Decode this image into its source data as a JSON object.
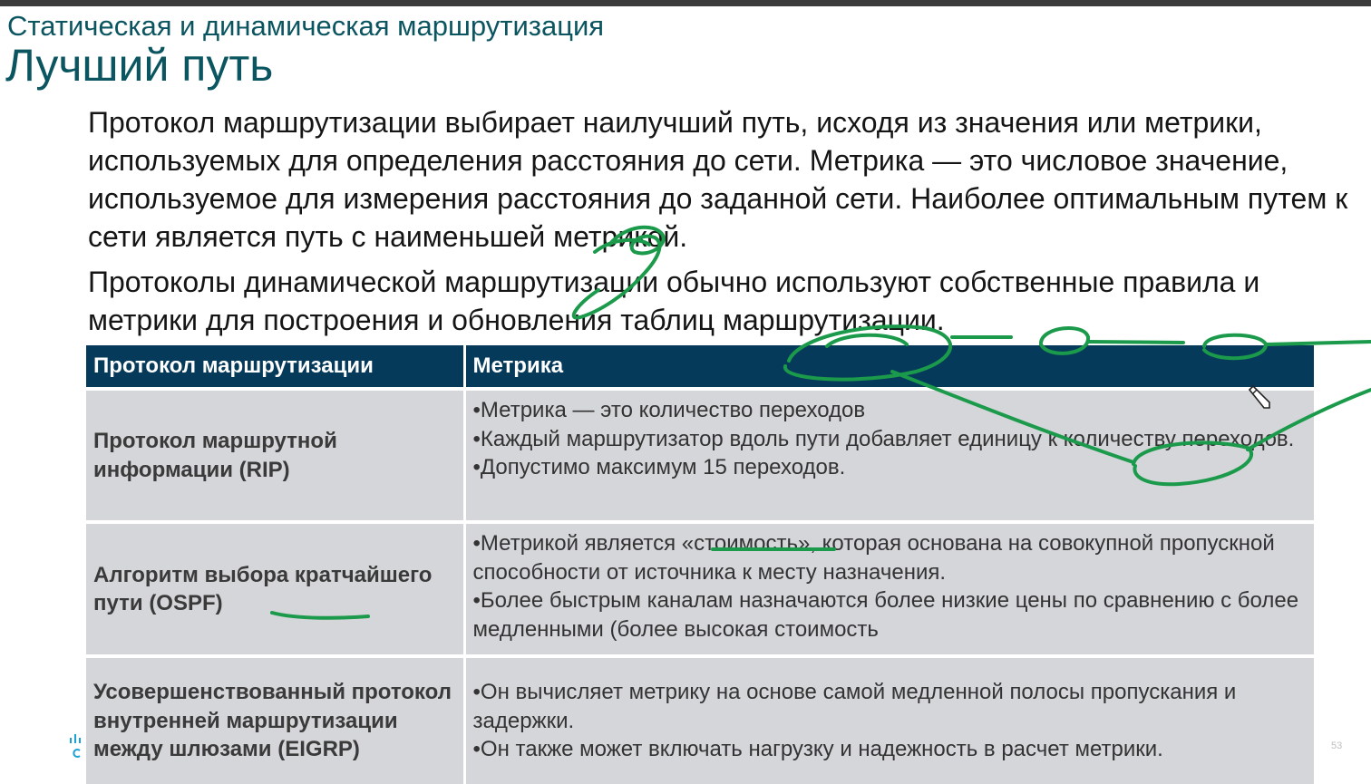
{
  "header": {
    "subtitle": "Статическая и динамическая маршрутизация",
    "title": "Лучший путь"
  },
  "body": {
    "paragraph1": "Протокол маршрутизации выбирает наилучший путь, исходя из значения или метрики, используемых для определения расстояния до сети. Метрика — это числовое значение, используемое для измерения расстояния до заданной сети. Наиболее оптимальным путем к сети является путь с наименьшей метрикой.",
    "paragraph2": "Протоколы динамической маршрутизации обычно используют собственные правила и метрики для построения и обновления таблиц маршрутизации."
  },
  "table": {
    "headers": [
      "Протокол маршрутизации",
      "Метрика"
    ],
    "rows": [
      {
        "protocol": "Протокол маршрутной информации (RIP)",
        "metric": [
          "•Метрика — это количество переходов",
          "•Каждый маршрутизатор вдоль пути добавляет единицу к количеству переходов.",
          "•Допустимо максимум 15 переходов."
        ]
      },
      {
        "protocol": "Алгоритм выбора кратчайшего пути (OSPF)",
        "metric": [
          "•Метрикой является «стоимость», которая основана на совокупной пропускной способности от источника к месту назначения.",
          "•Более быстрым каналам назначаются более низкие цены по сравнению с более медленными (более высокая стоимость"
        ]
      },
      {
        "protocol": "Усовершенствованный протокол внутренней маршрутизации между шлюзами (EIGRP)",
        "metric": [
          "•Он вычисляет метрику на основе самой медленной полосы пропускания и задержки.",
          "•Он также может включать нагрузку и надежность в расчет метрики."
        ]
      }
    ]
  },
  "footer": {
    "page_number": "53",
    "logo_icon": "cisco-logo-icon"
  },
  "annotations": {
    "pen_icon": "pen-cursor-icon"
  },
  "colors": {
    "title": "#0b5560",
    "table_header_bg": "#063a5a",
    "table_cell_bg": "#d4d6d9",
    "annotation_ink": "#1a9a4a"
  }
}
